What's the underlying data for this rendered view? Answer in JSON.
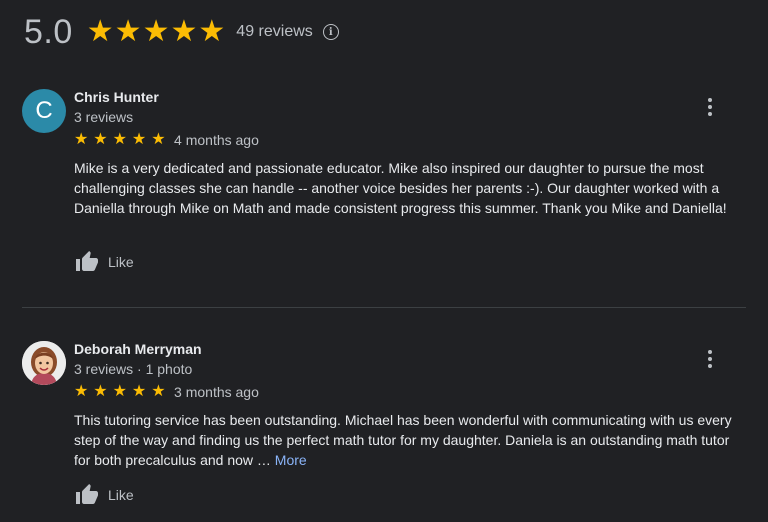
{
  "summary": {
    "rating": "5.0",
    "stars": 5,
    "review_count": "49 reviews"
  },
  "colors": {
    "background": "#202124",
    "star": "#fbbc04",
    "link": "#8ab4f8",
    "avatar_c": "#2b8aa8"
  },
  "reviews": [
    {
      "avatar_letter": "C",
      "author": "Chris Hunter",
      "meta": "3 reviews",
      "stars": 5,
      "time": "4 months ago",
      "text": "Mike is a very dedicated and passionate educator.  Mike also inspired our daughter to pursue the most challenging classes she can handle -- another voice besides her parents :-). Our daughter worked with a Daniella through Mike on Math and made consistent progress this summer.   Thank you Mike and Daniella!",
      "like_label": "Like"
    },
    {
      "avatar_icon": "profile-photo",
      "author": "Deborah Merryman",
      "meta": "3 reviews · 1 photo",
      "stars": 5,
      "time": "3 months ago",
      "text": "This tutoring service has been outstanding. Michael has been wonderful with communicating with us every step of the way and finding us the perfect math tutor for my daughter. Daniela is an outstanding math tutor for both precalculus and now …",
      "more_label": "More",
      "like_label": "Like"
    }
  ]
}
